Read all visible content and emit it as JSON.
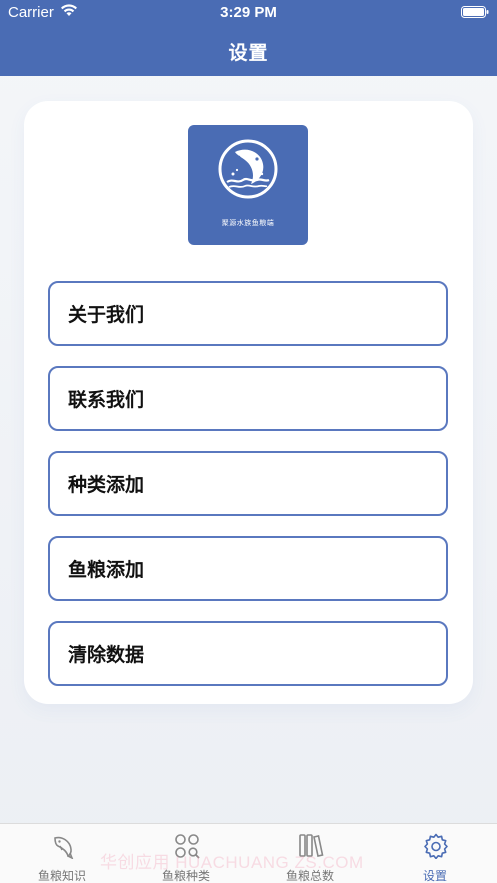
{
  "status_bar": {
    "carrier": "Carrier",
    "time": "3:29 PM"
  },
  "header": {
    "title": "设置",
    "background": "#4a6cb4"
  },
  "logo": {
    "text": "聚源水族鱼粮端"
  },
  "menu": [
    {
      "label": "关于我们"
    },
    {
      "label": "联系我们"
    },
    {
      "label": "种类添加"
    },
    {
      "label": "鱼粮添加"
    },
    {
      "label": "清除数据"
    }
  ],
  "tabs": [
    {
      "label": "鱼粮知识",
      "icon": "fish-icon",
      "active": false
    },
    {
      "label": "鱼粮种类",
      "icon": "grid-search-icon",
      "active": false
    },
    {
      "label": "鱼粮总数",
      "icon": "books-icon",
      "active": false
    },
    {
      "label": "设置",
      "icon": "gear-icon",
      "active": true
    }
  ],
  "watermark": "华创应用 HUACHUANG ZS.COM",
  "colors": {
    "accent": "#4a6cb4",
    "button_border": "#5a78bf",
    "tab_inactive": "#777777"
  }
}
